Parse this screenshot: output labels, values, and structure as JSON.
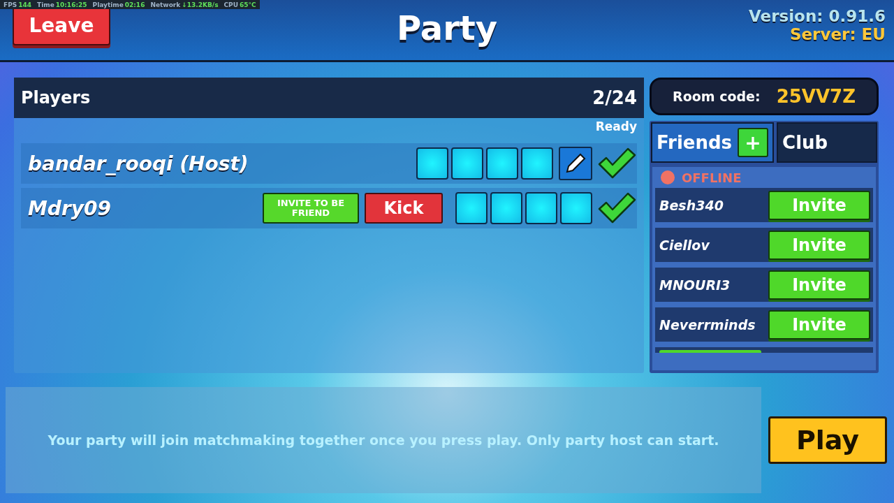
{
  "stats": [
    {
      "label": "FPS",
      "value": "144"
    },
    {
      "label": "Time",
      "value": "10:16:25"
    },
    {
      "label": "Playtime",
      "value": "02:16"
    },
    {
      "label": "Network",
      "value": "↓13.2KB/s"
    },
    {
      "label": "CPU",
      "value": "65°C"
    }
  ],
  "leave_button": "Leave",
  "title": "Party",
  "version": "Version: 0.91.6",
  "server": "Server: EU",
  "players_panel": {
    "title": "Players",
    "count": "2/24",
    "ready_header": "Ready",
    "players": [
      {
        "name": "bandar_rooqi (Host)",
        "editable": true,
        "ready": true
      },
      {
        "name": "Mdry09",
        "buttons": [
          {
            "kind": "friend",
            "label": "INVITE TO BE FRIEND"
          },
          {
            "kind": "kick",
            "label": "Kick"
          }
        ],
        "editable": false,
        "ready": true
      }
    ]
  },
  "room_code": {
    "label": "Room code:",
    "value": "25VV7Z"
  },
  "tabs": [
    {
      "label": "Friends",
      "selected": true,
      "kind": "friends"
    },
    {
      "label": "Club",
      "selected": false,
      "kind": "club"
    }
  ],
  "add_friend_button": "+",
  "friends": {
    "status": {
      "label": "OFFLINE",
      "color": "#f07264"
    },
    "items": [
      {
        "name": "Besh340",
        "button": "Invite"
      },
      {
        "name": "Ciellov",
        "button": "Invite"
      },
      {
        "name": "MNOURI3",
        "button": "Invite"
      },
      {
        "name": "Neverrminds",
        "button": "Invite"
      }
    ]
  },
  "message": "Your party will join matchmaking together once you press play. Only party host can start.",
  "play_button": "Play"
}
